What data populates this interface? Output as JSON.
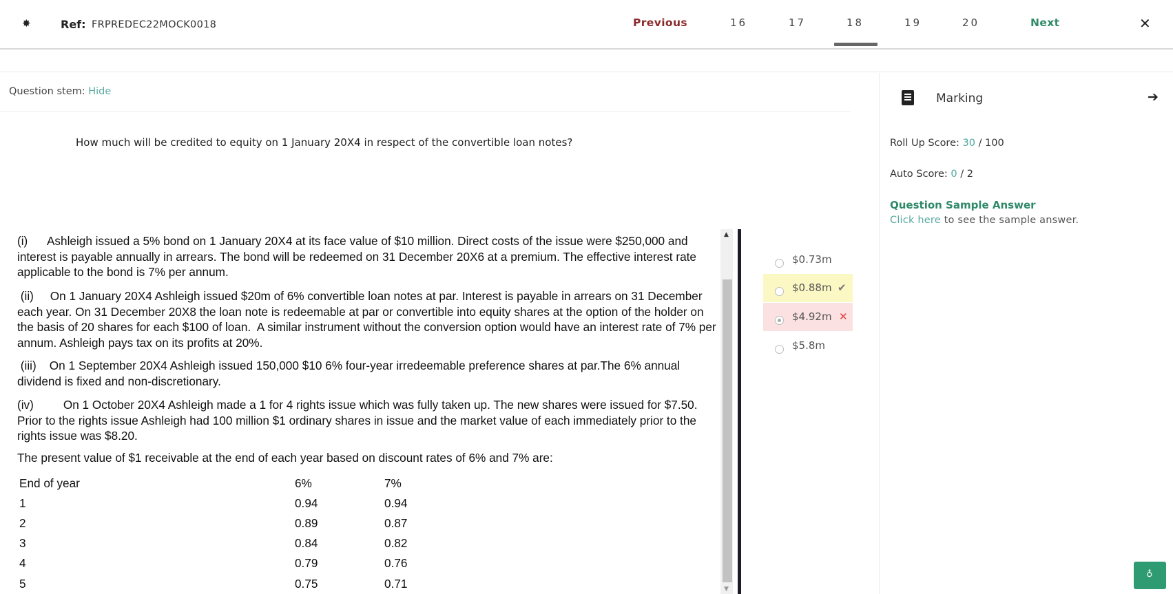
{
  "header": {
    "settings_icon": "gear-icon",
    "ref_label": "Ref:",
    "ref_value": "FRPREDEC22MOCK0018",
    "previous_label": "Previous",
    "question_numbers": [
      "16",
      "17",
      "18",
      "19",
      "20"
    ],
    "active_question": "18",
    "next_label": "Next",
    "close_icon": "close-icon"
  },
  "stem": {
    "label": "Question stem:",
    "toggle_label": "Hide"
  },
  "question": {
    "text": "How much will be credited to equity on 1 January 20X4 in respect of the convertible loan notes?"
  },
  "scenario": {
    "paragraphs": [
      "(i)      Ashleigh issued a 5% bond on 1 January 20X4 at its face value of $10 million. Direct costs of the issue were $250,000 and interest is payable annually in arrears. The bond will be redeemed on 31 December 20X6 at a premium. The effective interest rate applicable to the bond is 7% per annum.",
      " (ii)     On 1 January 20X4 Ashleigh issued $20m of 6% convertible loan notes at par. Interest is payable in arrears on 31 December each year. On 31 December 20X8 the loan note is redeemable at par or convertible into equity shares at the option of the holder on the basis of 20 shares for each $100 of loan.  A similar instrument without the conversion option would have an interest rate of 7% per annum. Ashleigh pays tax on its profits at 20%.",
      " (iii)    On 1 September 20X4 Ashleigh issued 150,000 $10 6% four-year irredeemable preference shares at par.The 6% annual dividend is fixed and non-discretionary.",
      "(iv)         On 1 October 20X4 Ashleigh made a 1 for 4 rights issue which was fully taken up. The new shares were issued for $7.50. Prior to the rights issue Ashleigh had 100 million $1 ordinary shares in issue and the market value of each immediately prior to the rights issue was $8.20.",
      "The present value of $1 receivable at the end of each year based on discount rates of 6% and 7% are:"
    ],
    "table": {
      "headers": [
        "End of year",
        "6%",
        "7%"
      ],
      "rows": [
        [
          "1",
          "0.94",
          "0.94"
        ],
        [
          "2",
          "0.89",
          "0.87"
        ],
        [
          "3",
          "0.84",
          "0.82"
        ],
        [
          "4",
          "0.79",
          "0.76"
        ],
        [
          "5",
          "0.75",
          "0.71"
        ]
      ]
    }
  },
  "options": [
    {
      "label": "$0.73m",
      "state": "none"
    },
    {
      "label": "$0.88m",
      "state": "correct",
      "mark": "✔"
    },
    {
      "label": "$4.92m",
      "state": "wrong",
      "mark": "✕"
    },
    {
      "label": "$5.8m",
      "state": "none"
    }
  ],
  "marking": {
    "title": "Marking",
    "icon": "document-icon",
    "collapse_icon": "arrow-right-icon",
    "rollup_label": "Roll Up Score:",
    "rollup_score": "30",
    "rollup_total": "/ 100",
    "auto_label": "Auto Score:",
    "auto_score": "0",
    "auto_total": "/ 2",
    "sample_title": "Question Sample Answer",
    "sample_link": "Click here",
    "sample_rest": " to see the sample answer."
  },
  "hint_button": {
    "icon": "lightbulb-icon"
  },
  "colors": {
    "previous": "#8b2a2a",
    "next": "#2e8a66",
    "correct_bg": "#fbf8c4",
    "wrong_bg": "#fbe1e1",
    "wrong_mark": "#e23c3c",
    "accent_teal": "#5aa9a0",
    "hint_button": "#2e9b72"
  }
}
